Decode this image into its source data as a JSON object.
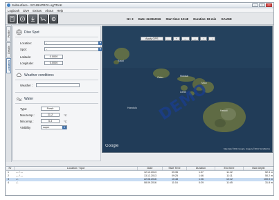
{
  "window": {
    "title": "Subsurface - SCUBAPRO LogTRAK",
    "btn_min": "_",
    "btn_max": "□",
    "btn_close": "×"
  },
  "menu": [
    "Logbook",
    "Dive",
    "Extras",
    "About",
    "Help"
  ],
  "toolbar": {
    "icons": [
      "logbook-icon",
      "dive-computer-icon",
      "download-icon",
      "profile-icon",
      "settings-icon"
    ],
    "dive_nr": "Nr: 3",
    "date": "Date: 22.08.2016",
    "start_time": "Start time: 10:48",
    "duration": "Duration: 86 min",
    "gauge": "GAUGE"
  },
  "tabs": [
    "Profile",
    "Details",
    "Location"
  ],
  "dive_spot": {
    "heading": "Dive Spot",
    "location_label": "Location:",
    "location_value": "-",
    "spot_label": "Spot:",
    "spot_value": "-",
    "latitude_label": "Latitude:",
    "latitude_value": "0.0000",
    "longitude_label": "Longitude:",
    "longitude_value": "0.0000"
  },
  "weather": {
    "heading": "Weather conditions",
    "weather_label": "Weather :",
    "weather_value": ""
  },
  "water": {
    "heading": "Water",
    "type_label": "Type:",
    "type_value": "Fresh",
    "max_temp_label": "Max.temp.:",
    "max_temp_value": "21.2",
    "min_temp_label": "Min.temp.:",
    "min_temp_value": "5.3",
    "temp_unit": "°C",
    "visibility_label": "Visibility",
    "visibility_value": "super"
  },
  "map": {
    "apply_gps": "Apply GPS",
    "nav_buttons": [
      "-",
      "+",
      "←",
      "→",
      "↑",
      "↓"
    ],
    "watermark": "DEMO",
    "places": [
      "Kauai",
      "Oahu",
      "Molokai",
      "Maui",
      "Lanai",
      "Hawaii",
      "Honolulu"
    ],
    "google": "Google",
    "copyright": "Map data ©2011 Google, Imagery ©2011 TerraMetrics",
    "colors": {
      "ocean": "#1f3a56",
      "land": "#5d6b45"
    }
  },
  "table": {
    "headers": [
      "Nr",
      "Location / Spot",
      "Date",
      "Start Time",
      "Duration",
      "End time",
      "Max Depth"
    ],
    "rows": [
      [
        "1",
        "--- / ---",
        "12.12.2013",
        "09:35",
        "1:37",
        "11:12",
        "52.3 m"
      ],
      [
        "2",
        "--- / ---",
        "13.12.2013",
        "09:25",
        "1:46",
        "11:11",
        "50.2 m"
      ],
      [
        "3",
        "-/-",
        "22.08.2016",
        "10:48",
        "1:26",
        "12:12",
        "100.9 m"
      ],
      [
        "4",
        "-/-",
        "08.09.2016",
        "11:16",
        "0:29",
        "11:45",
        "31.8 m"
      ]
    ],
    "selected_row": 2
  }
}
